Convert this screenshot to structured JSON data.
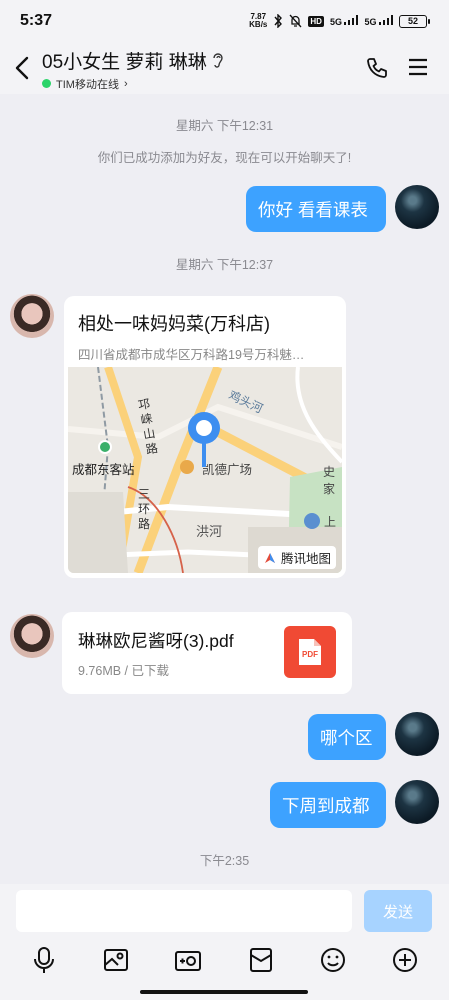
{
  "status_bar": {
    "time": "5:37",
    "net_speed_value": "7.87",
    "net_speed_unit": "KB/s",
    "hd_label": "HD",
    "signal1": "5G",
    "signal2": "5G",
    "battery": "52"
  },
  "header": {
    "title": "05小女生 萝莉 琳琳",
    "status": "TIM移动在线",
    "status_chevron": "›"
  },
  "messages": {
    "ts1": "星期六 下午12:31",
    "system_notice": "你们已成功添加为好友，现在可以开始聊天了!",
    "msg1": "你好 看看课表",
    "ts2": "星期六 下午12:37",
    "location": {
      "title": "相处一味妈妈菜(万科店)",
      "address": "四川省成都市成华区万科路19号万科魅…",
      "map_labels": {
        "road1": "邛崃山路",
        "river": "鸡头河",
        "station": "成都东客站",
        "plaza": "凯德广场",
        "ring": "三环路",
        "district": "洪河",
        "shi": "史家",
        "shang": "上",
        "brand": "腾讯地图"
      }
    },
    "file": {
      "name": "琳琳欧尼酱呀(3).pdf",
      "meta": "9.76MB / 已下载",
      "icon_text": "PDF"
    },
    "msg2": "哪个区",
    "msg3": "下周到成都",
    "ts3": "下午2:35"
  },
  "input": {
    "placeholder": "",
    "send_label": "发送"
  },
  "colors": {
    "bubble": "#3da2ff",
    "send_disabled": "#a7d3ff",
    "pdf": "#f04a34",
    "online": "#2bd46a",
    "map_pin": "#3d8ef0"
  }
}
